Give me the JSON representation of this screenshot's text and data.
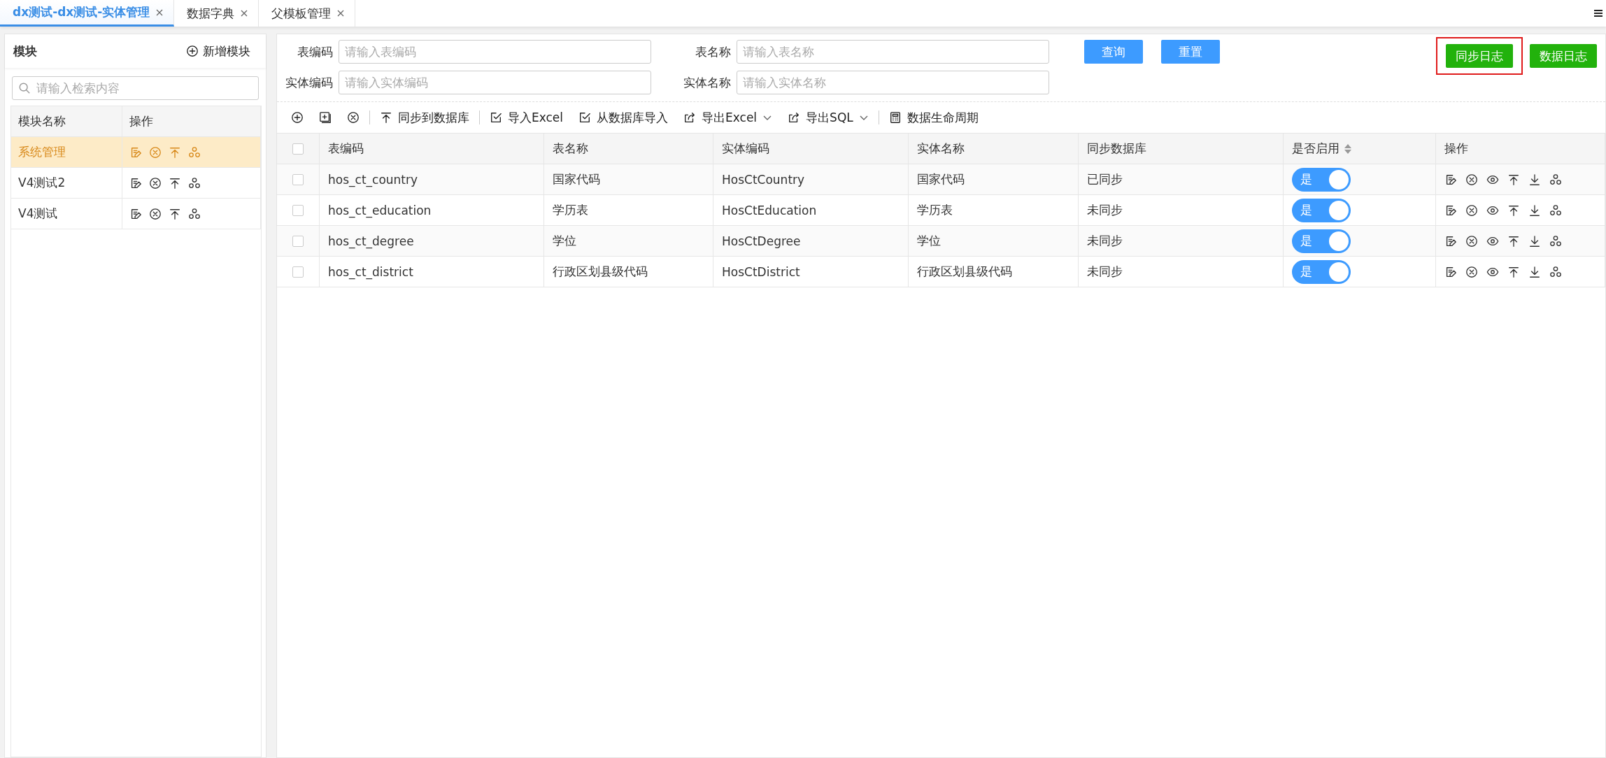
{
  "tabs": [
    {
      "label": "dx测试-dx测试-实体管理",
      "selected": true
    },
    {
      "label": "数据字典",
      "selected": false
    },
    {
      "label": "父模板管理",
      "selected": false
    }
  ],
  "sidebar": {
    "title": "模块",
    "add_button": "新增模块",
    "search": {
      "placeholder": "请输入检索内容"
    },
    "columns": [
      "模块名称",
      "操作"
    ],
    "rows": [
      {
        "name": "系统管理",
        "selected": true
      },
      {
        "name": "V4测试2",
        "selected": false
      },
      {
        "name": "V4测试",
        "selected": false
      }
    ]
  },
  "filters": [
    {
      "label": "表编码",
      "placeholder": "请输入表编码"
    },
    {
      "label": "表名称",
      "placeholder": "请输入表名称"
    },
    {
      "label": "实体编码",
      "placeholder": "请输入实体编码"
    },
    {
      "label": "实体名称",
      "placeholder": "请输入实体名称"
    }
  ],
  "search_buttons": [
    "查询",
    "重置"
  ],
  "log_buttons": [
    {
      "label": "同步日志",
      "highlighted": true
    },
    {
      "label": "数据日志",
      "highlighted": false
    }
  ],
  "toolbar": [
    {
      "label": "同步到数据库",
      "dropdown": false
    },
    {
      "label": "导入Excel",
      "dropdown": false
    },
    {
      "label": "从数据库导入",
      "dropdown": false
    },
    {
      "label": "导出Excel",
      "dropdown": true
    },
    {
      "label": "导出SQL",
      "dropdown": true
    },
    {
      "label": "数据生命周期",
      "dropdown": false
    }
  ],
  "table": {
    "select_all": {
      "checked": false
    },
    "columns": [
      {
        "label": "表编码",
        "sortable": false
      },
      {
        "label": "表名称",
        "sortable": false
      },
      {
        "label": "实体编码",
        "sortable": false
      },
      {
        "label": "实体名称",
        "sortable": false
      },
      {
        "label": "同步数据库",
        "sortable": false
      },
      {
        "label": "是否启用",
        "sortable": true
      },
      {
        "label": "操作",
        "sortable": false
      }
    ],
    "rows": [
      {
        "checked": false,
        "cells": [
          "hos_ct_country",
          "国家代码",
          "HosCtCountry",
          "国家代码",
          "已同步"
        ],
        "enabled": {
          "on": true,
          "label": "是"
        }
      },
      {
        "checked": false,
        "cells": [
          "hos_ct_education",
          "学历表",
          "HosCtEducation",
          "学历表",
          "未同步"
        ],
        "enabled": {
          "on": true,
          "label": "是"
        }
      },
      {
        "checked": false,
        "cells": [
          "hos_ct_degree",
          "学位",
          "HosCtDegree",
          "学位",
          "未同步"
        ],
        "enabled": {
          "on": true,
          "label": "是"
        }
      },
      {
        "checked": false,
        "cells": [
          "hos_ct_district",
          "行政区划县级代码",
          "HosCtDistrict",
          "行政区划县级代码",
          "未同步"
        ],
        "enabled": {
          "on": true,
          "label": "是"
        }
      }
    ]
  }
}
